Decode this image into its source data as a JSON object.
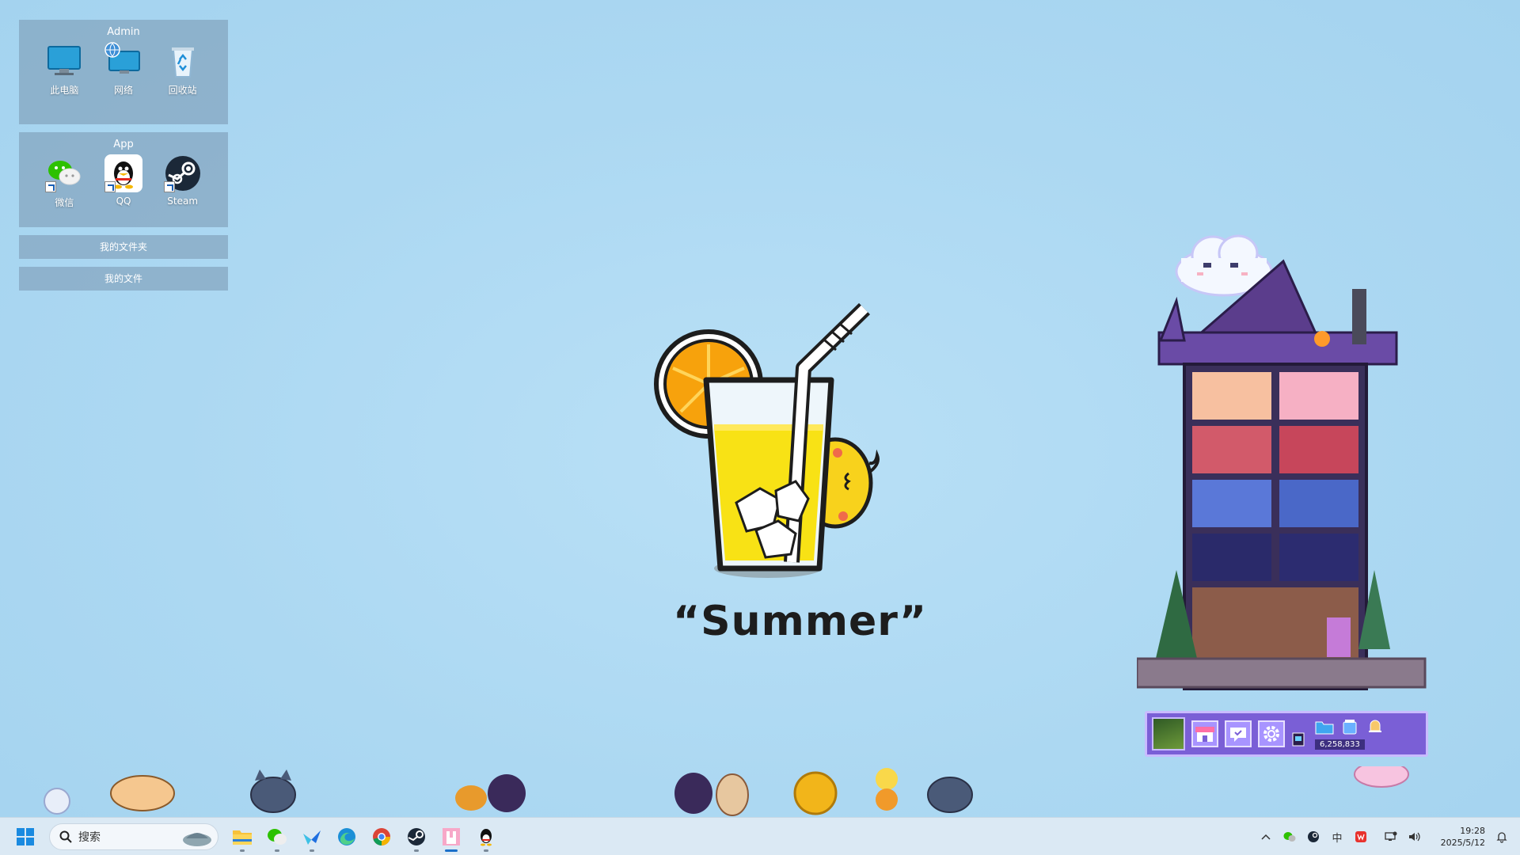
{
  "fences": {
    "admin": {
      "title": "Admin",
      "icons": [
        {
          "label": "此电脑",
          "icon": "monitor-icon"
        },
        {
          "label": "网络",
          "icon": "network-icon"
        },
        {
          "label": "回收站",
          "icon": "recycle-bin-icon"
        }
      ]
    },
    "app": {
      "title": "App",
      "icons": [
        {
          "label": "微信",
          "icon": "wechat-icon"
        },
        {
          "label": "QQ",
          "icon": "qq-icon"
        },
        {
          "label": "Steam",
          "icon": "steam-icon"
        }
      ]
    },
    "folders": [
      {
        "label": "我的文件夹"
      },
      {
        "label": "我的文件"
      }
    ]
  },
  "wallpaper": {
    "text": "“Summer”"
  },
  "widget": {
    "coin_value": "6,258,833"
  },
  "taskbar": {
    "search_placeholder": "搜索",
    "apps": [
      {
        "icon": "file-explorer-icon"
      },
      {
        "icon": "wechat-icon"
      },
      {
        "icon": "feishu-icon"
      },
      {
        "icon": "edge-icon"
      },
      {
        "icon": "chrome-icon"
      },
      {
        "icon": "steam-icon"
      },
      {
        "icon": "pixel-house-icon"
      },
      {
        "icon": "qq-icon"
      }
    ],
    "tray": {
      "input_method": "中",
      "time": "19:28",
      "date": "2025/5/12"
    }
  },
  "colors": {
    "desktop_bg": "#acd8f2",
    "taskbar_bg": "#dbe9f4",
    "accent": "#1a6fc9",
    "widget_purple": "#7a5fd6"
  }
}
